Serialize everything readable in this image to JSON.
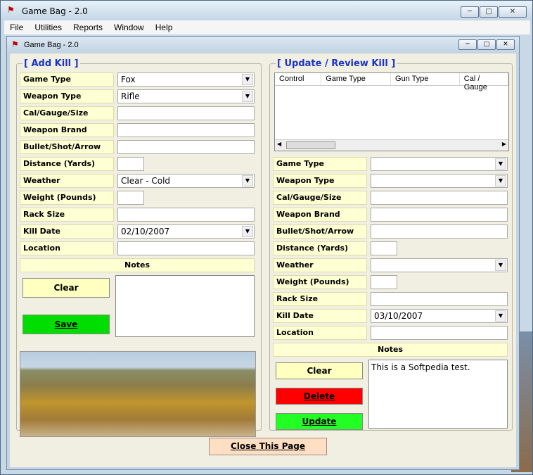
{
  "app": {
    "title": "Game Bag  -  2.0",
    "child_title": "Game Bag - 2.0"
  },
  "menu": [
    "File",
    "Utilities",
    "Reports",
    "Window",
    "Help"
  ],
  "add": {
    "title": "[ Add Kill ]",
    "labels": [
      "Game Type",
      "Weapon Type",
      "Cal/Gauge/Size",
      "Weapon Brand",
      "Bullet/Shot/Arrow",
      "Distance (Yards)",
      "Weather",
      "Weight (Pounds)",
      "Rack Size",
      "Kill Date",
      "Location"
    ],
    "game_type": "Fox",
    "weapon_type": "Rifle",
    "weather": "Clear - Cold",
    "kill_date": "02/10/2007",
    "notes_label": "Notes",
    "clear": "Clear",
    "save": "Save"
  },
  "review": {
    "title": "[ Update / Review Kill ]",
    "columns": [
      "Control",
      "Game Type",
      "Gun Type",
      "Cal / Gauge"
    ],
    "labels": [
      "Game Type",
      "Weapon Type",
      "Cal/Gauge/Size",
      "Weapon Brand",
      "Bullet/Shot/Arrow",
      "Distance (Yards)",
      "Weather",
      "Weight (Pounds)",
      "Rack Size",
      "Kill Date",
      "Location"
    ],
    "kill_date": "03/10/2007",
    "notes_label": "Notes",
    "notes_text": "This is a Softpedia test.",
    "clear": "Clear",
    "delete": "Delete",
    "update": "Update"
  },
  "close": "Close This Page",
  "colors": {
    "label_bg": "#ffffd4",
    "group_title": "#1a33c9",
    "save": "#00dd00",
    "delete": "#ff0000",
    "update": "#22ff22",
    "clear": "#ffffc0"
  }
}
